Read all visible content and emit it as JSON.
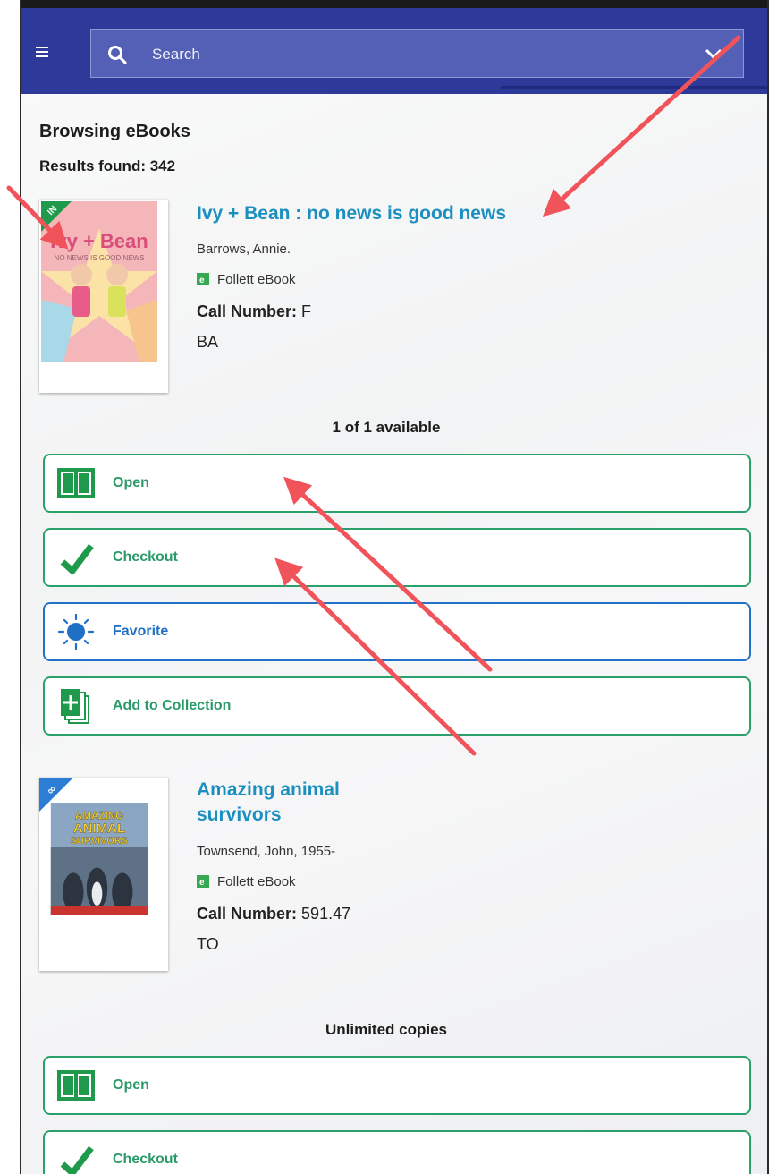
{
  "header": {
    "search": {
      "placeholder": "Search"
    }
  },
  "page": {
    "title": "Browsing eBooks",
    "results": "Results found: 342"
  },
  "books": [
    {
      "badge": "IN",
      "cover_text": [
        "Ivy + Bean",
        "NO NEWS IS GOOD NEWS"
      ],
      "title": "Ivy + Bean : no news is good news",
      "author": "Barrows, Annie.",
      "format": "Follett eBook",
      "call_number_label": "Call Number:",
      "call_number": "F",
      "call_number_line2": "BA",
      "availability": "1 of 1 available",
      "actions": {
        "open": "Open",
        "checkout": "Checkout",
        "favorite": "Favorite",
        "add_collection": "Add to Collection"
      }
    },
    {
      "badge": "∞",
      "cover_text": [
        "AMAZING",
        "ANIMAL",
        "SURVIVORS"
      ],
      "title_line1": "Amazing animal",
      "title_line2": "survivors",
      "author": "Townsend, John, 1955-",
      "format": "Follett eBook",
      "call_number_label": "Call Number:",
      "call_number": "591.47",
      "call_number_line2": "TO",
      "availability": "Unlimited copies",
      "actions": {
        "open": "Open",
        "checkout": "Checkout"
      }
    }
  ],
  "colors": {
    "appbar": "#2d3a9a",
    "link": "#1a8fc0",
    "action_green": "#2aa06b",
    "action_blue": "#2472c8",
    "annotation_arrow": "#f0545a"
  }
}
